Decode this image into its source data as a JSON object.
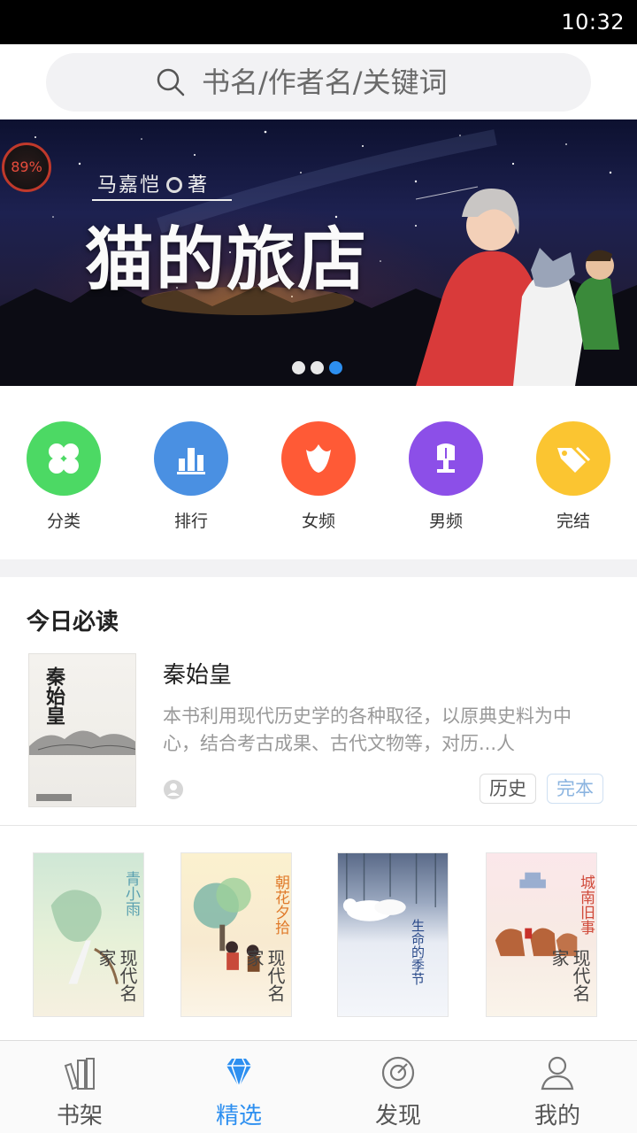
{
  "status_bar": {
    "time": "10:32"
  },
  "search": {
    "placeholder": "书名/作者名/关键词"
  },
  "banner": {
    "progress_badge": "89%",
    "author": "马嘉恺",
    "author_suffix": "著",
    "title": "猫的旅店",
    "active_slide": 3,
    "slide_count": 3
  },
  "categories": [
    {
      "label": "分类",
      "icon": "clover-icon",
      "color": "#4cd964"
    },
    {
      "label": "排行",
      "icon": "bar-chart-icon",
      "color": "#4a90e2"
    },
    {
      "label": "女频",
      "icon": "tulip-icon",
      "color": "#ff5a36"
    },
    {
      "label": "男频",
      "icon": "shield-crest-icon",
      "color": "#8c4fe8"
    },
    {
      "label": "完结",
      "icon": "tag-icon",
      "color": "#fbc531"
    }
  ],
  "today": {
    "heading": "今日必读",
    "book": {
      "title": "秦始皇",
      "cover_text": "秦始皇",
      "description": "本书利用现代历史学的各种取径，以原典史料为中心，结合考古成果、古代文物等，对历...人",
      "tags": [
        "历史",
        "完本"
      ]
    }
  },
  "books": [
    {
      "cover_title": "青小雨",
      "series": "现代名家"
    },
    {
      "cover_title": "朝花夕拾",
      "series": "现代名家"
    },
    {
      "cover_title": "生命的季节",
      "series": ""
    },
    {
      "cover_title": "城南旧事",
      "series": "现代名家"
    }
  ],
  "tabbar": [
    {
      "label": "书架",
      "icon": "bookshelf-icon",
      "active": false
    },
    {
      "label": "精选",
      "icon": "diamond-icon",
      "active": true
    },
    {
      "label": "发现",
      "icon": "compass-icon",
      "active": false
    },
    {
      "label": "我的",
      "icon": "person-icon",
      "active": false
    }
  ],
  "colors": {
    "accent": "#2d8ff0",
    "section_bg": "#f2f2f4"
  }
}
